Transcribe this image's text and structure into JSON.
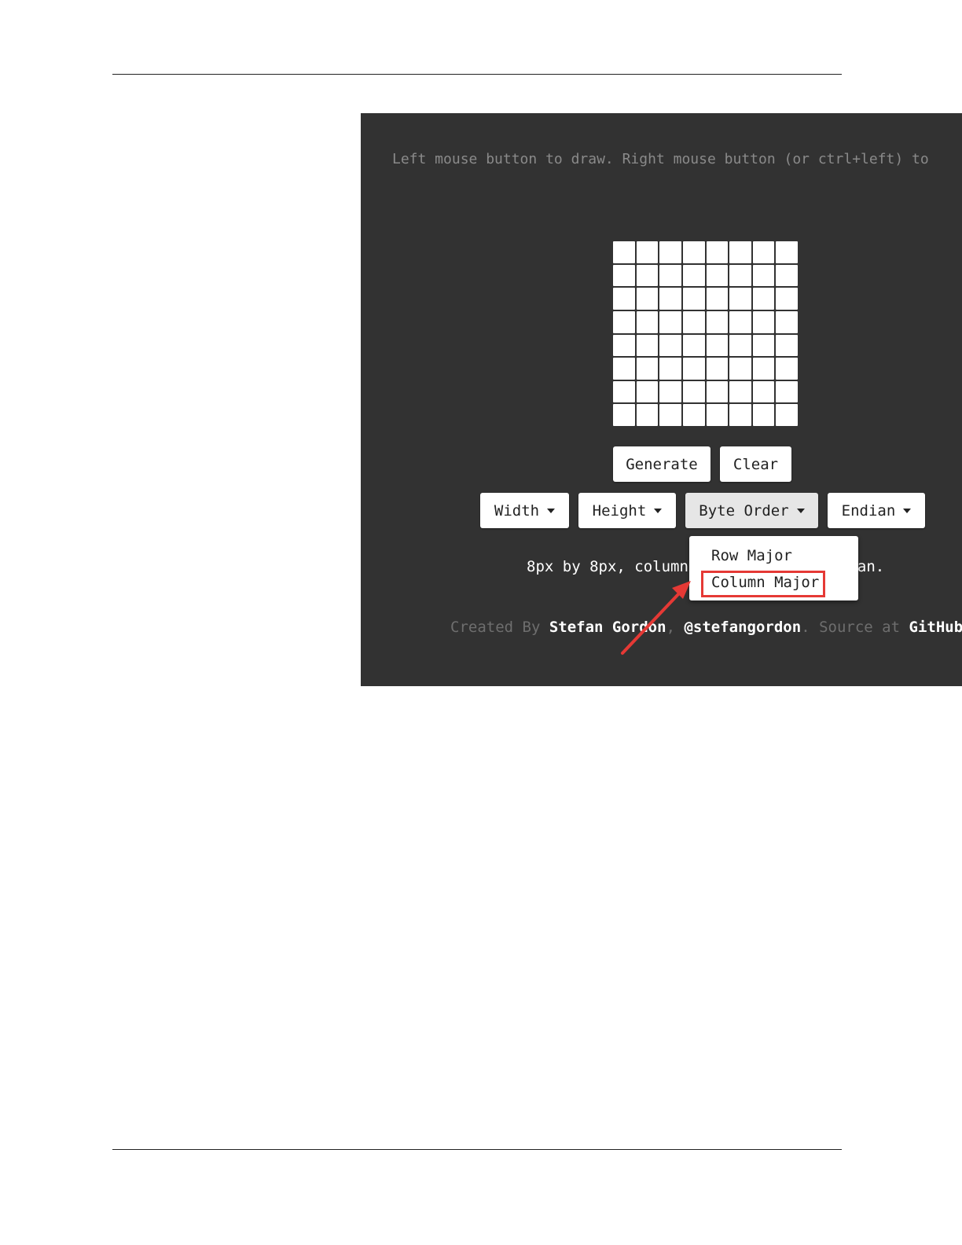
{
  "instructions": "Left mouse button to draw. Right mouse button (or ctrl+left) to",
  "grid": {
    "columns": 8,
    "rows": 8
  },
  "buttons": {
    "generate": "Generate",
    "clear": "Clear"
  },
  "dropdowns": {
    "width": "Width",
    "height": "Height",
    "byte_order": "Byte Order",
    "endian": "Endian"
  },
  "status": {
    "left": "8px by 8px, column",
    "right": "an."
  },
  "byte_order_menu": {
    "items": [
      "Row Major",
      "Column Major"
    ],
    "highlighted": "Column Major"
  },
  "credits": {
    "created_by": "Created By",
    "author": "Stefan Gordon",
    "sep1": ",",
    "handle": "@stefangordon",
    "sep2": ".",
    "source_at": "Source at",
    "source": "GitHub"
  },
  "colors": {
    "app_background": "#323232",
    "annotation_red": "#e53935"
  },
  "icons": [
    "caret-down-icon",
    "red-arrow-annotation"
  ]
}
